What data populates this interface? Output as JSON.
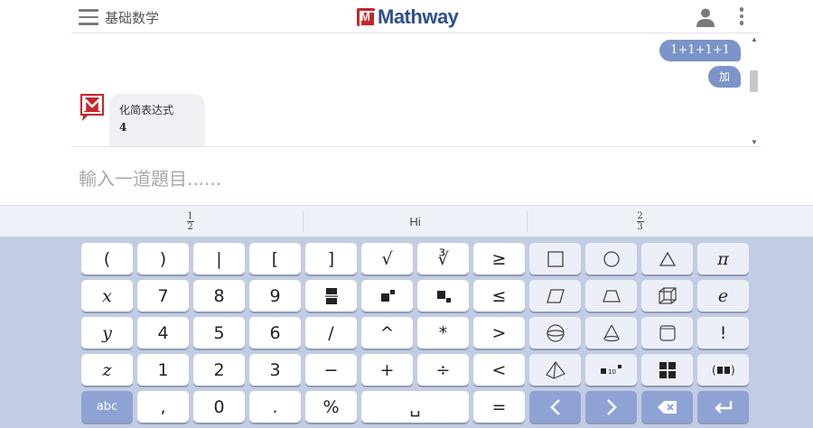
{
  "header": {
    "topic": "基础数学",
    "logo_text": "Mathway"
  },
  "chat": {
    "user_question": "1+1+1+1",
    "user_operation": "加",
    "bot_title": "化简表达式",
    "bot_answer": "4"
  },
  "input": {
    "placeholder": "輸入一道題目......"
  },
  "suggestions": [
    {
      "numerator": "1",
      "denominator": "2"
    },
    {
      "text": "Hi"
    },
    {
      "numerator": "2",
      "denominator": "3"
    }
  ],
  "keys": {
    "row1": [
      "(",
      ")",
      "|",
      "[",
      "]",
      "√",
      "∛",
      "≥"
    ],
    "row2": [
      "x",
      "7",
      "8",
      "9",
      "≤"
    ],
    "row3": [
      "y",
      "4",
      "5",
      "6",
      "/",
      "^",
      "*",
      ">"
    ],
    "row4": [
      "z",
      "1",
      "2",
      "3",
      "−",
      "+",
      "÷",
      "<"
    ],
    "row5": [
      "abc",
      ",",
      "0",
      ".",
      "%",
      "␣",
      "="
    ],
    "special": {
      "pi": "π",
      "e": "e",
      "factorial": "!"
    }
  },
  "colors": {
    "keyboard_bg": "#c2cce2",
    "accent": "#8ea3d4",
    "user_bubble": "#7b94c9",
    "logo_blue": "#2e4f8d",
    "logo_red": "#c8242b"
  }
}
